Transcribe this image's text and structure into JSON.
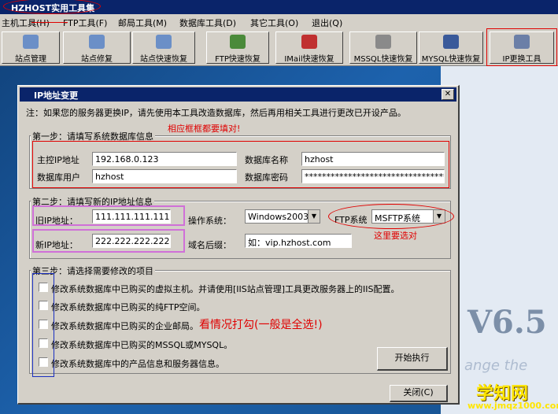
{
  "app": {
    "title": "HZHOST实用工具集",
    "accent": "#0a246a"
  },
  "menu": [
    "主机工具(H)",
    "FTP工具(F)",
    "邮局工具(M)",
    "数据库工具(D)",
    "其它工具(O)",
    "退出(Q)"
  ],
  "toolbar": [
    {
      "label": "站点管理",
      "icon": "gears-icon",
      "color": "#6b8fc7"
    },
    {
      "label": "站点修复",
      "icon": "gears-icon",
      "color": "#6b8fc7"
    },
    {
      "label": "站点快速恢复",
      "icon": "gears-icon",
      "color": "#6b8fc7"
    },
    {
      "label": "FTP快速恢复",
      "icon": "ftp-icon",
      "color": "#4a8a3a"
    },
    {
      "label": "IMail快速恢复",
      "icon": "mail-icon",
      "color": "#c03030"
    },
    {
      "label": "MSSQL快速恢复",
      "icon": "database-icon",
      "color": "#8a8a8a"
    },
    {
      "label": "MYSQL快速恢复",
      "icon": "sql-icon",
      "color": "#3a5a9a"
    },
    {
      "label": "IP更换工具",
      "icon": "network-icon",
      "color": "#6b7fa7"
    }
  ],
  "background": {
    "version": "V6.5",
    "tagline": "ange the"
  },
  "dialog": {
    "title": "IP地址变更",
    "notice": "注：如果您的服务器更换IP，请先使用本工具改造数据库，然后再用相关工具进行更改已开设产品。",
    "step1": {
      "label": "第一步：请填写系统数据库信息",
      "host_ip_label": "主控IP地址",
      "host_ip": "192.168.0.123",
      "db_name_label": "数据库名称",
      "db_name": "hzhost",
      "db_user_label": "数据库用户",
      "db_user": "hzhost",
      "db_pass_label": "数据库密码",
      "db_pass": "**********************************"
    },
    "step2": {
      "label": "第二步：请填写新的IP地址信息",
      "old_ip_label": "旧IP地址：",
      "old_ip": "111.111.111.111",
      "new_ip_label": "新IP地址：",
      "new_ip": "222.222.222.222",
      "os_label": "操作系统：",
      "os": "Windows2003",
      "ftp_label": "FTP系统",
      "ftp": "MSFTP系统",
      "domain_label": "域名后缀：",
      "domain": "如：vip.hzhost.com"
    },
    "step3": {
      "label": "第三步：请选择需要修改的项目",
      "items": [
        "修改系统数据库中已购买的虚拟主机。并请使用[IIS站点管理]工具更改服务器上的IIS配置。",
        "修改系统数据库中已购买的纯FTP空间。",
        "修改系统数据库中已购买的企业邮局。",
        "修改系统数据库中已购买的MSSQL或MYSQL。",
        "修改系统数据库中的产品信息和服务器信息。"
      ],
      "start_button": "开始执行"
    },
    "close_button": "关闭(C)",
    "close_x": "✕"
  },
  "annotations": {
    "fields_note": "相应框框都要填对!",
    "select_note": "这里要选对",
    "check_note": "看情况打勾(一般是全选!)"
  },
  "watermark": {
    "title": "学知网",
    "url": "www.jmqz1000.com"
  }
}
